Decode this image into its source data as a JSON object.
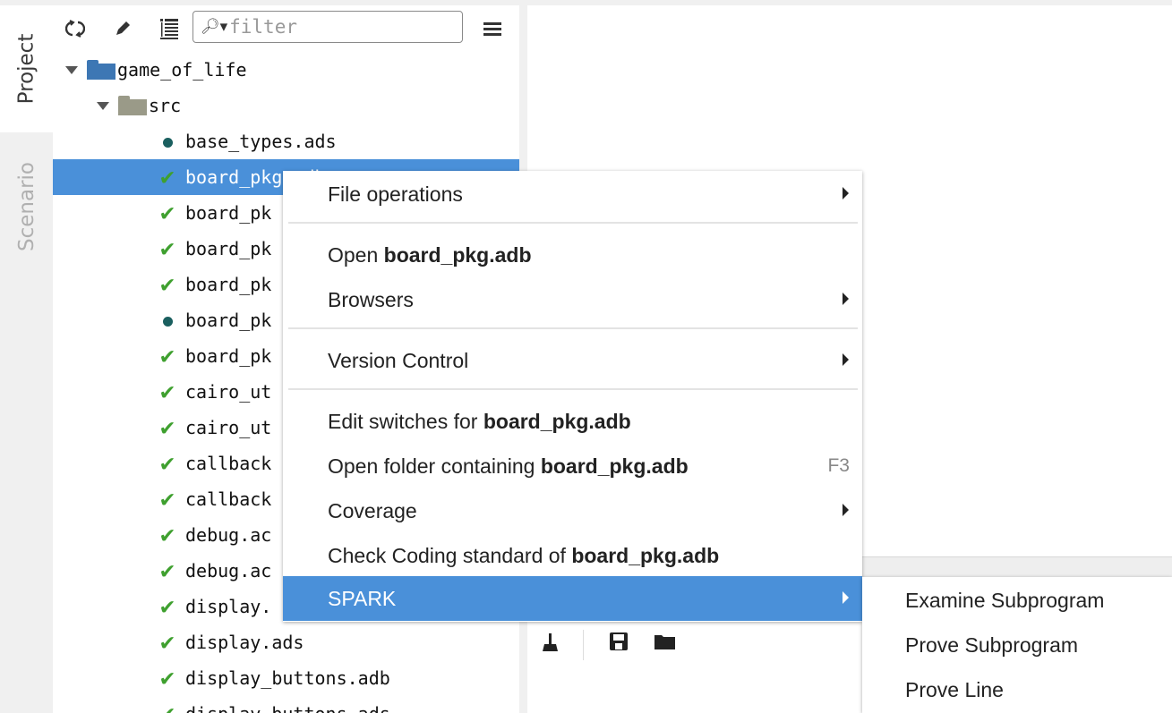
{
  "side_tabs": [
    {
      "label": "Project"
    },
    {
      "label": "Scenario"
    }
  ],
  "toolbar": {
    "filter_placeholder": "filter"
  },
  "tree": {
    "project": "game_of_life",
    "folder": "src",
    "files": [
      {
        "name": "base_types.ads",
        "status": "dot"
      },
      {
        "name": "board_pkg.adb",
        "status": "check",
        "selected": true
      },
      {
        "name": "board_pk",
        "status": "check"
      },
      {
        "name": "board_pk",
        "status": "check"
      },
      {
        "name": "board_pk",
        "status": "check"
      },
      {
        "name": "board_pk",
        "status": "dot"
      },
      {
        "name": "board_pk",
        "status": "check"
      },
      {
        "name": "cairo_ut",
        "status": "check"
      },
      {
        "name": "cairo_ut",
        "status": "check"
      },
      {
        "name": "callback",
        "status": "check"
      },
      {
        "name": "callback",
        "status": "check"
      },
      {
        "name": "debug.ac",
        "status": "check"
      },
      {
        "name": "debug.ac",
        "status": "check"
      },
      {
        "name": "display.",
        "status": "check"
      },
      {
        "name": "display.ads",
        "status": "check"
      },
      {
        "name": "display_buttons.adb",
        "status": "check"
      },
      {
        "name": "display_buttons.ads",
        "status": "check"
      }
    ]
  },
  "context_menu": {
    "file_operations": "File operations",
    "open_prefix": "Open ",
    "target_file": "board_pkg.adb",
    "browsers": "Browsers",
    "version_control": "Version Control",
    "edit_switches_prefix": "Edit switches for ",
    "open_folder_prefix": "Open folder containing ",
    "open_folder_shortcut": "F3",
    "coverage": "Coverage",
    "check_coding_prefix": "Check Coding standard of ",
    "spark": "SPARK"
  },
  "spark_submenu": [
    {
      "label": "Examine Subprogram"
    },
    {
      "label": "Prove Subprogram"
    },
    {
      "label": "Prove Line"
    }
  ],
  "colors": {
    "selection": "#4a90d9",
    "check": "#3fa02f",
    "dot": "#1a5f5f",
    "project_folder": "#3d77b4",
    "src_folder": "#9a9a88"
  },
  "icons": {
    "refresh": "refresh-icon",
    "edit": "pencil-icon",
    "list": "list-icon",
    "menu": "hamburger-menu-icon",
    "clean": "broom-icon",
    "save": "save-icon",
    "open_folder": "folder-open-icon"
  }
}
